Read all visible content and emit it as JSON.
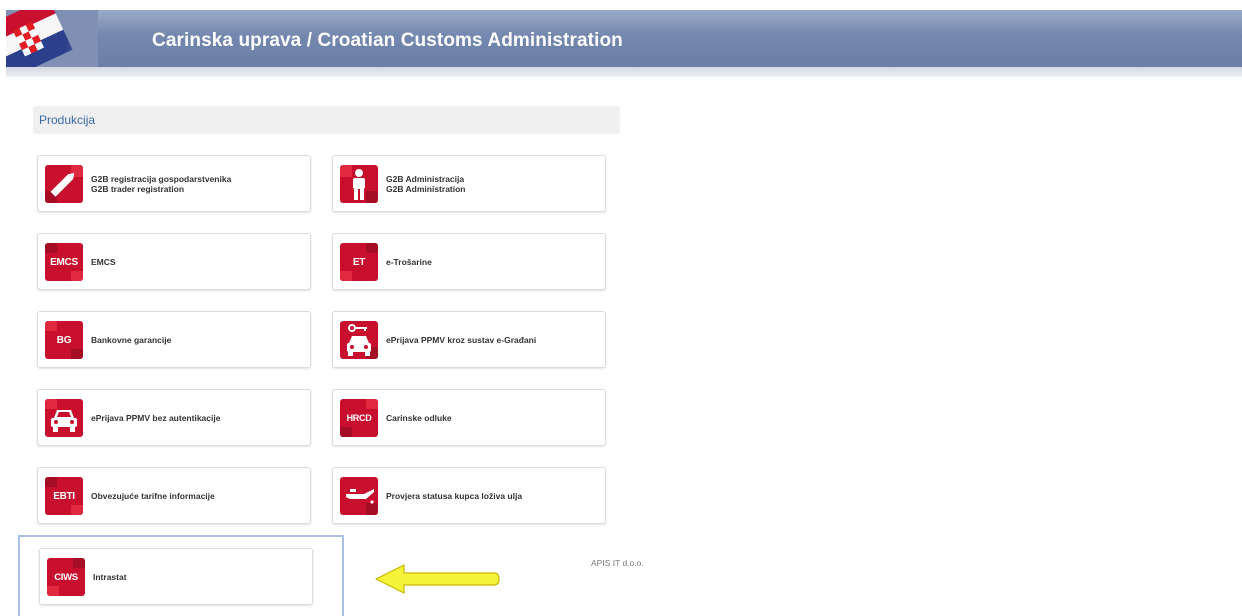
{
  "header": {
    "title": "Carinska uprava / Croatian Customs Administration"
  },
  "section": {
    "title": "Produkcija"
  },
  "tiles": [
    {
      "icon": "pencil-icon",
      "badge": "",
      "line1": "G2B registracija gospodarstvenika",
      "line2": "G2B trader registration"
    },
    {
      "icon": "person-icon",
      "badge": "",
      "line1": "G2B Administracija",
      "line2": "G2B Administration"
    },
    {
      "icon": "emcs-icon",
      "badge": "EMCS",
      "line1": "EMCS",
      "line2": ""
    },
    {
      "icon": "et-icon",
      "badge": "ET",
      "line1": "e-Trošarine",
      "line2": ""
    },
    {
      "icon": "bg-icon",
      "badge": "BG",
      "line1": "Bankovne garancije",
      "line2": ""
    },
    {
      "icon": "car-key-icon",
      "badge": "",
      "line1": "ePrijava PPMV kroz sustav e-Građani",
      "line2": ""
    },
    {
      "icon": "car-icon",
      "badge": "",
      "line1": "ePrijava PPMV bez autentikacije",
      "line2": ""
    },
    {
      "icon": "hrcd-icon",
      "badge": "HRCD",
      "line1": "Carinske odluke",
      "line2": ""
    },
    {
      "icon": "ebti-icon",
      "badge": "EBTI",
      "line1": "Obvezujuće tarifne informacije",
      "line2": ""
    },
    {
      "icon": "oil-can-icon",
      "badge": "",
      "line1": "Provjera statusa kupca loživa ulja",
      "line2": ""
    },
    {
      "icon": "ciws-icon",
      "badge": "CIWS",
      "line1": "Intrastat",
      "line2": ""
    }
  ],
  "footer": {
    "company": "APIS IT d.o.o."
  },
  "colors": {
    "header": "#7487ae",
    "tile_icon_red": "#c8102e",
    "section_text": "#3a6aa8",
    "arrow": "#f5f23a"
  }
}
